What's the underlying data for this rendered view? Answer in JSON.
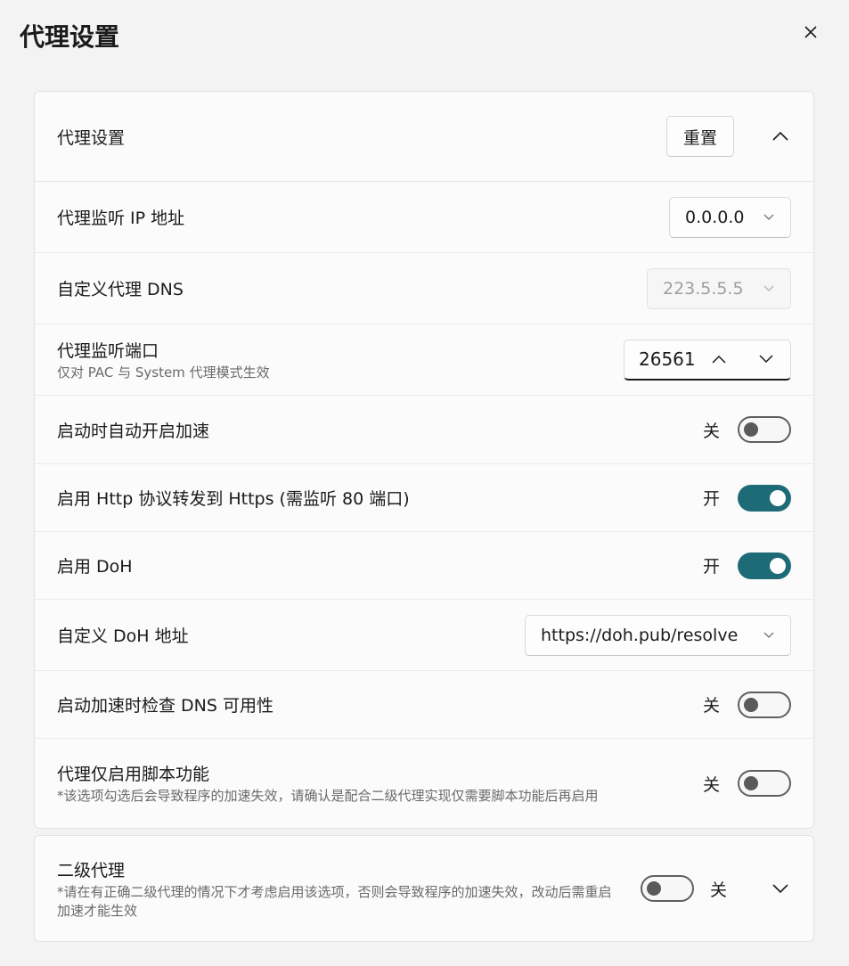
{
  "page": {
    "title": "代理设置"
  },
  "card1": {
    "header": {
      "title": "代理设置",
      "reset_label": "重置"
    },
    "rows": {
      "listen_ip": {
        "label": "代理监听 IP 地址",
        "value": "0.0.0.0"
      },
      "custom_dns": {
        "label": "自定义代理 DNS",
        "value": "223.5.5.5"
      },
      "listen_port": {
        "label": "代理监听端口",
        "sub": "仅对 PAC 与 System 代理模式生效",
        "value": "26561"
      },
      "auto_start": {
        "label": "启动时自动开启加速",
        "state": "关",
        "on": false
      },
      "http_forward": {
        "label": "启用 Http 协议转发到 Https (需监听 80 端口)",
        "state": "开",
        "on": true
      },
      "doh": {
        "label": "启用 DoH",
        "state": "开",
        "on": true
      },
      "doh_addr": {
        "label": "自定义 DoH 地址",
        "value": "https://doh.pub/resolve"
      },
      "dns_check": {
        "label": "启动加速时检查 DNS 可用性",
        "state": "关",
        "on": false
      },
      "script_only": {
        "label": "代理仅启用脚本功能",
        "sub": "*该选项勾选后会导致程序的加速失效，请确认是配合二级代理实现仅需要脚本功能后再启用",
        "state": "关",
        "on": false
      }
    }
  },
  "card2": {
    "title": "二级代理",
    "sub": "*请在有正确二级代理的情况下才考虑启用该选项，否则会导致程序的加速失效，改动后需重启加速才能生效",
    "state": "关",
    "on": false
  },
  "colors": {
    "accent": "#1c6b76",
    "background": "#f3f3f3",
    "card": "#fbfbfb"
  },
  "icons": [
    "close-icon",
    "chevron-up-icon",
    "chevron-down-icon"
  ]
}
